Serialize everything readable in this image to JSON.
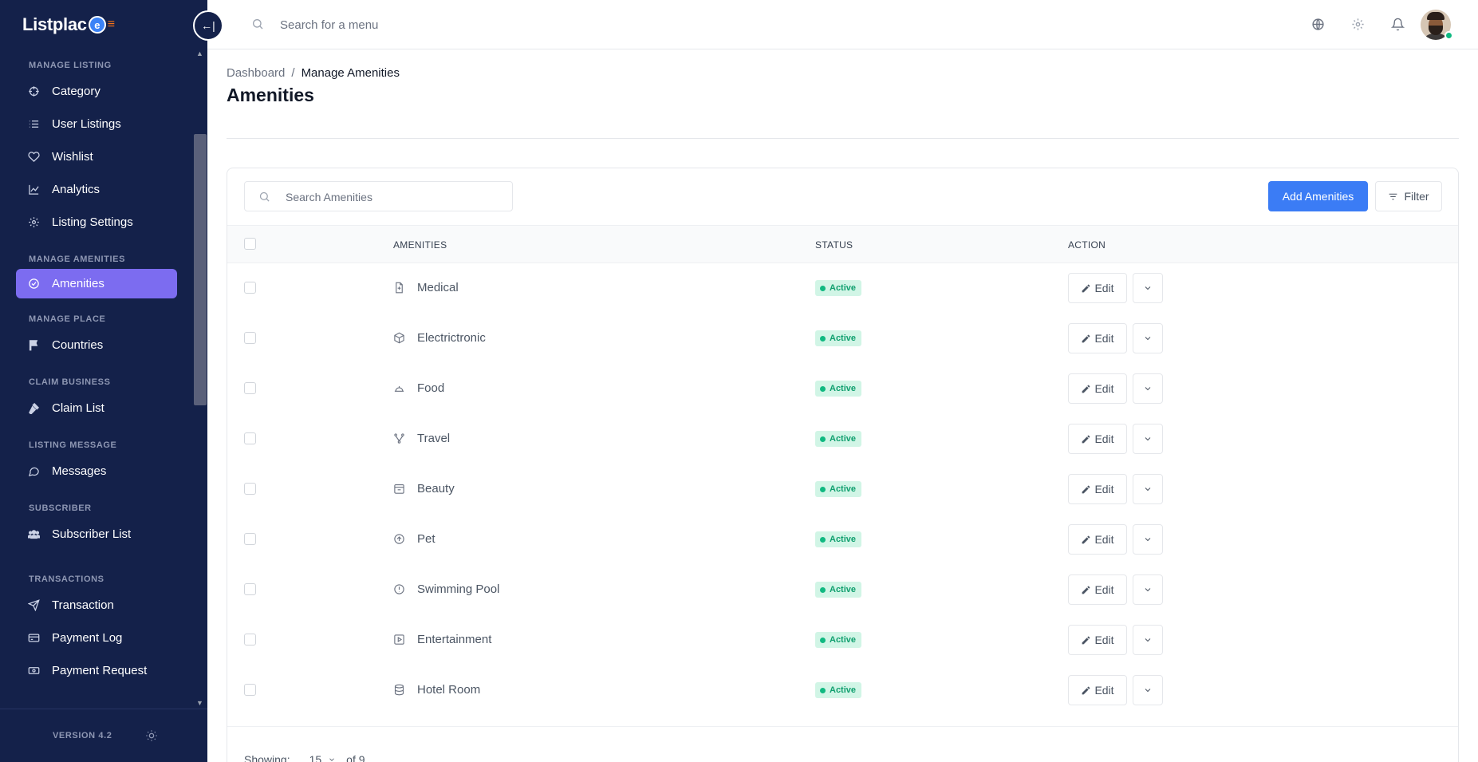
{
  "app": {
    "logo_text": "Listplac",
    "logo_badge": "e",
    "logo_dashes": "≡",
    "collapse_icon": "←|",
    "version": "VERSION 4.2"
  },
  "sidebar": {
    "sections": [
      {
        "title": "MANAGE LISTING",
        "items": [
          {
            "label": "Category",
            "icon": "crosshair-icon"
          },
          {
            "label": "User Listings",
            "icon": "list-icon"
          },
          {
            "label": "Wishlist",
            "icon": "heart-icon"
          },
          {
            "label": "Analytics",
            "icon": "chart-icon"
          },
          {
            "label": "Listing Settings",
            "icon": "gear-icon"
          }
        ]
      },
      {
        "title": "MANAGE AMENITIES",
        "items": [
          {
            "label": "Amenities",
            "icon": "check-circle-icon",
            "active": true
          }
        ]
      },
      {
        "title": "MANAGE PLACE",
        "items": [
          {
            "label": "Countries",
            "icon": "flag-icon"
          }
        ]
      },
      {
        "title": "CLAIM BUSINESS",
        "items": [
          {
            "label": "Claim List",
            "icon": "gavel-icon"
          }
        ]
      },
      {
        "title": "LISTING MESSAGE",
        "items": [
          {
            "label": "Messages",
            "icon": "chat-icon"
          }
        ]
      },
      {
        "title": "SUBSCRIBER",
        "items": [
          {
            "label": "Subscriber List",
            "icon": "users-icon"
          }
        ]
      },
      {
        "title": "TRANSACTIONS",
        "items": [
          {
            "label": "Transaction",
            "icon": "send-icon"
          },
          {
            "label": "Payment Log",
            "icon": "card-icon"
          },
          {
            "label": "Payment Request",
            "icon": "cash-icon"
          }
        ]
      }
    ]
  },
  "topbar": {
    "search_placeholder": "Search for a menu",
    "icons": [
      "globe-icon",
      "gear-icon",
      "bell-icon"
    ],
    "online_color": "#10b981"
  },
  "breadcrumb": {
    "root": "Dashboard",
    "separator": "/",
    "current": "Manage Amenities"
  },
  "page": {
    "title": "Amenities"
  },
  "toolbar": {
    "search_placeholder": "Search Amenities",
    "add_label": "Add Amenities",
    "filter_label": "Filter"
  },
  "table": {
    "columns": [
      "AMENITIES",
      "STATUS",
      "ACTION"
    ],
    "edit_label": "Edit",
    "rows": [
      {
        "name": "Medical",
        "icon": "file-icon",
        "status": "Active"
      },
      {
        "name": "Electrictronic",
        "icon": "box-icon",
        "status": "Active"
      },
      {
        "name": "Food",
        "icon": "dish-icon",
        "status": "Active"
      },
      {
        "name": "Travel",
        "icon": "route-icon",
        "status": "Active"
      },
      {
        "name": "Beauty",
        "icon": "calendar-icon",
        "status": "Active"
      },
      {
        "name": "Pet",
        "icon": "arrow-up-circle-icon",
        "status": "Active"
      },
      {
        "name": "Swimming Pool",
        "icon": "alert-circle-icon",
        "status": "Active"
      },
      {
        "name": "Entertainment",
        "icon": "play-square-icon",
        "status": "Active"
      },
      {
        "name": "Hotel Room",
        "icon": "database-icon",
        "status": "Active"
      }
    ]
  },
  "pagination": {
    "showing_label": "Showing:",
    "per_page": "15",
    "of_label": "of",
    "total": "9"
  },
  "colors": {
    "sidebar_bg": "#14214a",
    "active_item": "#7c6cf0",
    "primary_button": "#3b7cf5",
    "status_active": "#10b981"
  }
}
